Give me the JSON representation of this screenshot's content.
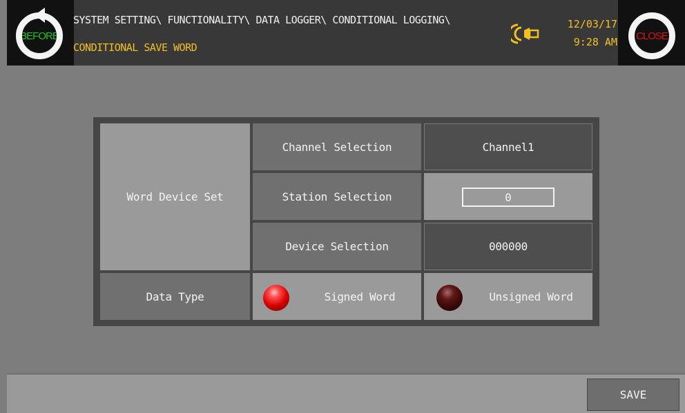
{
  "header": {
    "before_label": "BEFORE",
    "close_label": "CLOSE",
    "path": "SYSTEM SETTING\\ FUNCTIONALITY\\ DATA LOGGER\\ CONDITIONAL LOGGING\\",
    "subtitle": "CONDITIONAL SAVE WORD",
    "date": "12/03/17",
    "time": "9:28 AM",
    "speaker_icon": "speaker-icon"
  },
  "table": {
    "word_device_set": "Word Device Set",
    "channel_label": "Channel Selection",
    "channel_value": "Channel1",
    "station_label": "Station Selection",
    "station_value": "0",
    "device_label": "Device Selection",
    "device_value": "000000",
    "data_type_label": "Data Type",
    "signed_label": "Signed Word",
    "unsigned_label": "Unsigned Word"
  },
  "footer": {
    "save_label": "SAVE"
  },
  "colors": {
    "accent": "#f2c020",
    "before": "#18c818",
    "close": "#e01010",
    "led_on": "#d60000",
    "led_off": "#3a0808"
  }
}
